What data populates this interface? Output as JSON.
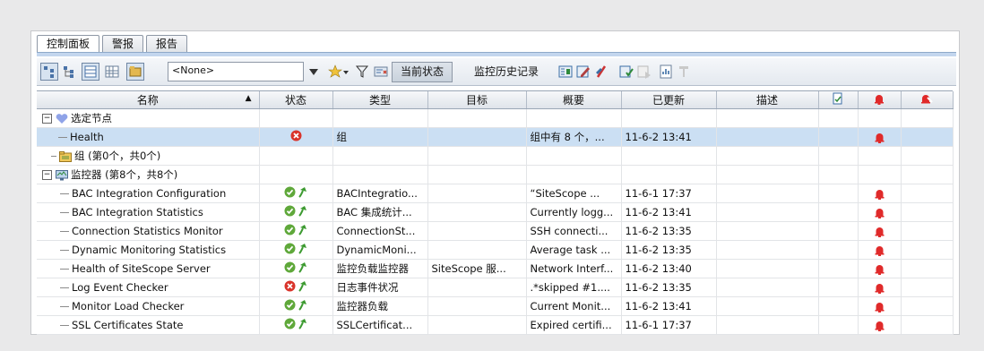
{
  "tabs": [
    "控制面板",
    "警报",
    "报告"
  ],
  "toolbar": {
    "select_value": "<None>",
    "current_state_button": "当前状态",
    "history_button": "监控历史记录"
  },
  "columns": {
    "name": "名称",
    "status": "状态",
    "type": "类型",
    "target": "目标",
    "summary": "概要",
    "updated": "已更新",
    "description": "描述"
  },
  "tree": {
    "selected_nodes": "选定节点",
    "health": {
      "name": "Health",
      "status": "error",
      "type": "组",
      "summary": "组中有 8 个，...",
      "updated": "11-6-2 13:41"
    },
    "groups": "组 (第0个，共0个)",
    "monitors": "监控器 (第8个，共8个)"
  },
  "rows": [
    {
      "name": "BAC Integration Configuration",
      "status": "ok",
      "type": "BACIntegratio...",
      "target": "",
      "summary": "“SiteScope ...",
      "updated": "11-6-1 17:37"
    },
    {
      "name": "BAC Integration Statistics",
      "status": "ok",
      "type": "BAC 集成统计...",
      "target": "",
      "summary": "Currently logg...",
      "updated": "11-6-2 13:41"
    },
    {
      "name": "Connection Statistics Monitor",
      "status": "ok",
      "type": "ConnectionSt...",
      "target": "",
      "summary": "SSH connecti...",
      "updated": "11-6-2 13:35"
    },
    {
      "name": "Dynamic Monitoring Statistics",
      "status": "ok",
      "type": "DynamicMoni...",
      "target": "",
      "summary": "Average task ...",
      "updated": "11-6-2 13:35"
    },
    {
      "name": "Health of SiteScope Server",
      "status": "ok",
      "type": "监控负载监控器",
      "target": "SiteScope 服...",
      "summary": "Network Interf...",
      "updated": "11-6-2 13:40"
    },
    {
      "name": "Log Event Checker",
      "status": "error",
      "type": "日志事件状况",
      "target": "",
      "summary": ".*skipped #1....",
      "updated": "11-6-2 13:35"
    },
    {
      "name": "Monitor Load Checker",
      "status": "ok",
      "type": "监控器负载",
      "target": "",
      "summary": "Current Monit...",
      "updated": "11-6-2 13:41"
    },
    {
      "name": "SSL Certificates State",
      "status": "ok",
      "type": "SSLCertificat...",
      "target": "",
      "summary": "Expired certifi...",
      "updated": "11-6-1 17:37"
    }
  ],
  "colors": {
    "selection": "#cbdff3",
    "ok": "#5fa83a",
    "error": "#d9342b",
    "bell": "#e02a2a"
  }
}
